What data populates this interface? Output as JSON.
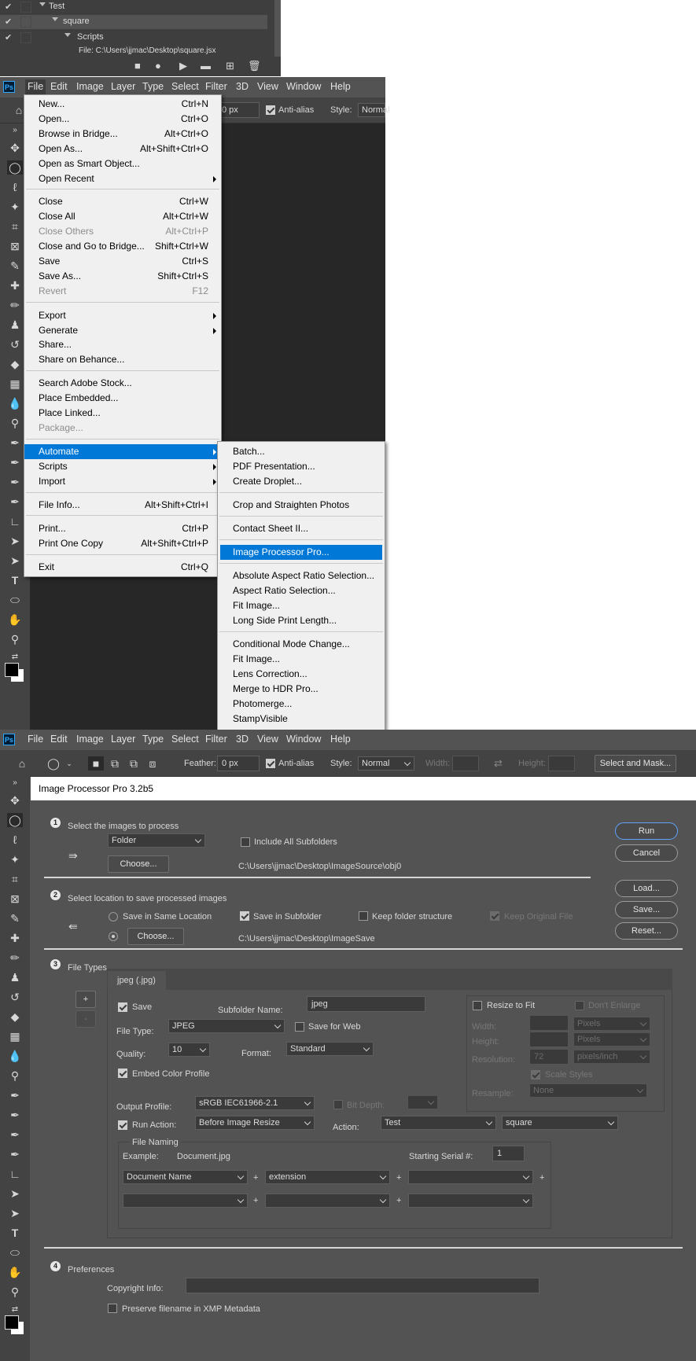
{
  "actions_panel": {
    "rows": [
      {
        "label": "Test",
        "checked": true
      },
      {
        "label": "square",
        "checked": true
      },
      {
        "label": "Scripts",
        "checked": true
      },
      {
        "label": "File: C:\\Users\\jjmac\\Desktop\\square.jsx"
      }
    ],
    "buttons": [
      "stop",
      "record",
      "play",
      "new-set",
      "new-action",
      "delete"
    ]
  },
  "menubar": {
    "logo": "Ps",
    "items": [
      "File",
      "Edit",
      "Image",
      "Layer",
      "Type",
      "Select",
      "Filter",
      "3D",
      "View",
      "Window",
      "Help"
    ]
  },
  "options_bar_top": {
    "feather_value": "0 px",
    "antialias_label": "Anti-alias",
    "style_label": "Style:",
    "style_value": "Normal"
  },
  "file_menu": {
    "items": [
      {
        "label": "New...",
        "shortcut": "Ctrl+N"
      },
      {
        "label": "Open...",
        "shortcut": "Ctrl+O"
      },
      {
        "label": "Browse in Bridge...",
        "shortcut": "Alt+Ctrl+O"
      },
      {
        "label": "Open As...",
        "shortcut": "Alt+Shift+Ctrl+O"
      },
      {
        "label": "Open as Smart Object...",
        "shortcut": ""
      },
      {
        "label": "Open Recent",
        "shortcut": ""
      },
      {
        "label": "Close",
        "shortcut": "Ctrl+W"
      },
      {
        "label": "Close All",
        "shortcut": "Alt+Ctrl+W"
      },
      {
        "label": "Close Others",
        "shortcut": "Alt+Ctrl+P"
      },
      {
        "label": "Close and Go to Bridge...",
        "shortcut": "Shift+Ctrl+W"
      },
      {
        "label": "Save",
        "shortcut": "Ctrl+S"
      },
      {
        "label": "Save As...",
        "shortcut": "Shift+Ctrl+S"
      },
      {
        "label": "Revert",
        "shortcut": "F12"
      },
      {
        "label": "Export",
        "shortcut": ""
      },
      {
        "label": "Generate",
        "shortcut": ""
      },
      {
        "label": "Share...",
        "shortcut": ""
      },
      {
        "label": "Share on Behance...",
        "shortcut": ""
      },
      {
        "label": "Search Adobe Stock...",
        "shortcut": ""
      },
      {
        "label": "Place Embedded...",
        "shortcut": ""
      },
      {
        "label": "Place Linked...",
        "shortcut": ""
      },
      {
        "label": "Package...",
        "shortcut": ""
      },
      {
        "label": "Automate",
        "shortcut": ""
      },
      {
        "label": "Scripts",
        "shortcut": ""
      },
      {
        "label": "Import",
        "shortcut": ""
      },
      {
        "label": "File Info...",
        "shortcut": "Alt+Shift+Ctrl+I"
      },
      {
        "label": "Print...",
        "shortcut": "Ctrl+P"
      },
      {
        "label": "Print One Copy",
        "shortcut": "Alt+Shift+Ctrl+P"
      },
      {
        "label": "Exit",
        "shortcut": "Ctrl+Q"
      }
    ]
  },
  "automate_menu": {
    "items": [
      "Batch...",
      "PDF Presentation...",
      "Create Droplet...",
      "Crop and Straighten Photos",
      "Contact Sheet II...",
      "Image Processor Pro...",
      "Absolute Aspect Ratio Selection...",
      "Aspect Ratio Selection...",
      "Fit Image...",
      "Long Side Print Length...",
      "Conditional Mode Change...",
      "Fit Image...",
      "Lens Correction...",
      "Merge to HDR Pro...",
      "Photomerge...",
      "StampVisible"
    ]
  },
  "options_bar_bottom": {
    "feather_label": "Feather:",
    "feather_value": "0 px",
    "antialias_label": "Anti-alias",
    "style_label": "Style:",
    "style_value": "Normal",
    "width_label": "Width:",
    "height_label": "Height:",
    "select_mask_label": "Select and Mask..."
  },
  "dialog": {
    "title": "Image Processor Pro 3.2b5",
    "section1": {
      "number": "1",
      "title": "Select the images to process",
      "source_value": "Folder",
      "include_subfolders_label": "Include All Subfolders",
      "choose_label": "Choose...",
      "path": "C:\\Users\\jjmac\\Desktop\\ImageSource\\obj0"
    },
    "section2": {
      "number": "2",
      "title": "Select location to save processed images",
      "same_location_label": "Save in Same Location",
      "save_subfolder_label": "Save in Subfolder",
      "keep_structure_label": "Keep folder structure",
      "keep_original_label": "Keep Original File",
      "choose_label": "Choose...",
      "path": "C:\\Users\\jjmac\\Desktop\\ImageSave"
    },
    "section3": {
      "number": "3",
      "title": "File Types",
      "add_label": "+",
      "remove_label": "-",
      "tab_label": "jpeg (.jpg)",
      "save_label": "Save",
      "subfolder_name_label": "Subfolder Name:",
      "subfolder_name_value": "jpeg",
      "file_type_label": "File Type:",
      "file_type_value": "JPEG",
      "save_for_web_label": "Save for Web",
      "quality_label": "Quality:",
      "quality_value": "10",
      "format_label": "Format:",
      "format_value": "Standard",
      "embed_profile_label": "Embed Color Profile",
      "resize_to_fit_label": "Resize to Fit",
      "dont_enlarge_label": "Don't Enlarge",
      "width_label": "Width:",
      "height_label": "Height:",
      "resolution_label": "Resolution:",
      "resolution_value": "72",
      "pixels1": "Pixels",
      "pixels2": "Pixels",
      "pixels_inch": "pixels/inch",
      "scale_styles_label": "Scale Styles",
      "resample_label": "Resample:",
      "resample_value": "None",
      "output_profile_label": "Output Profile:",
      "output_profile_value": "sRGB IEC61966-2.1",
      "bit_depth_label": "Bit Depth:",
      "run_action_label": "Run Action:",
      "run_action_value": "Before Image Resize",
      "action_label": "Action:",
      "action_set_value": "Test",
      "action_value": "square",
      "file_naming_label": "File Naming",
      "example_label": "Example:",
      "example_value": "Document.jpg",
      "serial_label": "Starting Serial #:",
      "serial_value": "1",
      "naming_row1": [
        "Document Name",
        "extension",
        ""
      ],
      "naming_row2": [
        "",
        "",
        ""
      ],
      "plus": "+"
    },
    "section4": {
      "number": "4",
      "title": "Preferences",
      "copyright_label": "Copyright Info:",
      "preserve_label": "Preserve filename in XMP Metadata"
    },
    "buttons": {
      "run": "Run",
      "cancel": "Cancel",
      "load": "Load...",
      "save": "Save...",
      "reset": "Reset..."
    }
  },
  "colors": {
    "menu_highlight": "#0078d7",
    "panel_bg": "#535353",
    "default_button_border": "#5ea3ff"
  }
}
